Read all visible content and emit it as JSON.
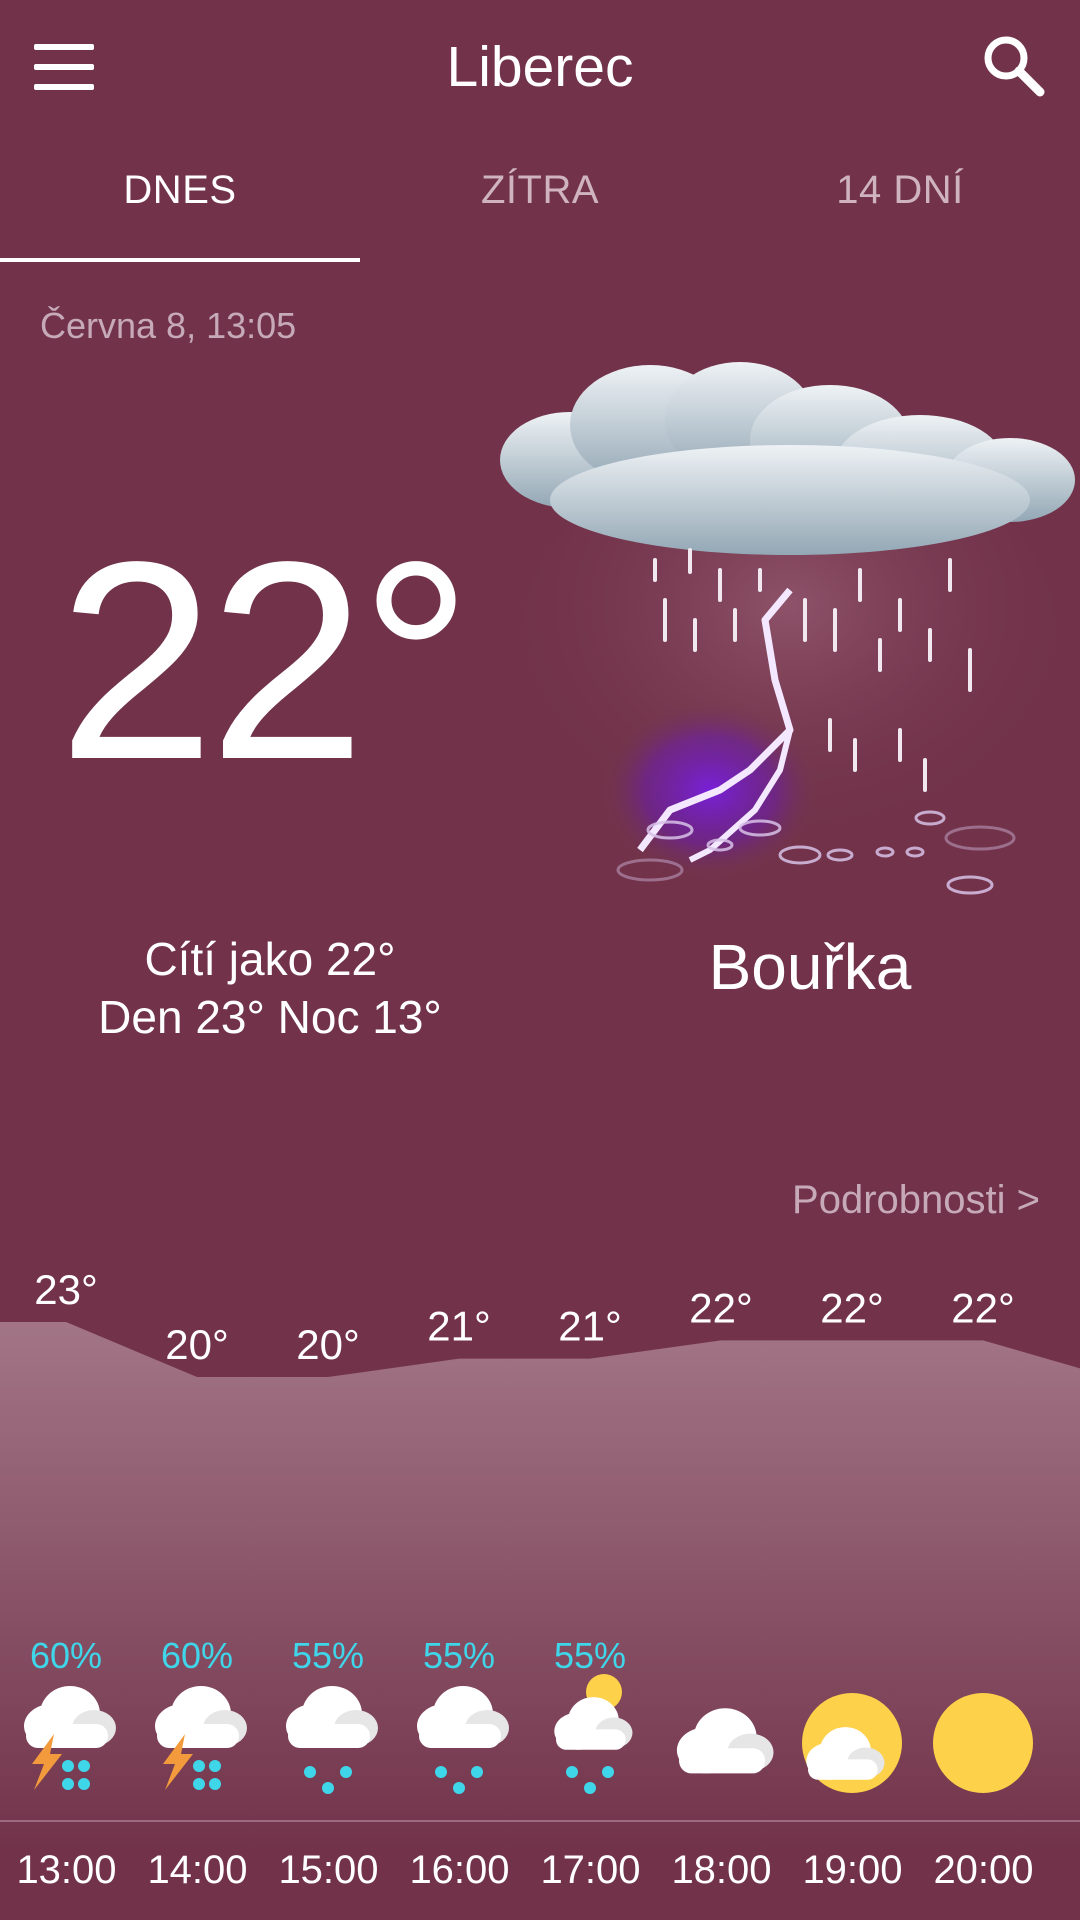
{
  "header": {
    "city": "Liberec",
    "menu_icon": "hamburger-menu-icon",
    "search_icon": "search-icon"
  },
  "tabs": [
    {
      "label": "DNES",
      "active": true
    },
    {
      "label": "ZÍTRA",
      "active": false
    },
    {
      "label": "14 DNÍ",
      "active": false
    }
  ],
  "current": {
    "datetime": "Června 8, 13:05",
    "temperature": "22°",
    "feels_like": "Cítí jako 22°",
    "day_night": "Den 23° Noc 13°",
    "condition": "Bouřka",
    "condition_icon": "thunderstorm-icon"
  },
  "details_link": "Podrobnosti >",
  "colors": {
    "background": "#72334a",
    "precip_text": "#3fd6ea",
    "sun": "#fdd14a",
    "lightning": "#f39b3c",
    "rain_drop": "#3fd6ea"
  },
  "chart_data": {
    "type": "area",
    "x": [
      "13:00",
      "14:00",
      "15:00",
      "16:00",
      "17:00",
      "18:00",
      "19:00",
      "20:00"
    ],
    "values": [
      23,
      20,
      20,
      21,
      21,
      22,
      22,
      22
    ],
    "value_labels": [
      "23°",
      "20°",
      "20°",
      "21°",
      "21°",
      "22°",
      "22°",
      "22°"
    ],
    "precipitation": [
      "60%",
      "60%",
      "55%",
      "55%",
      "55%",
      "",
      "",
      ""
    ],
    "icons": [
      "thunder-rain-icon",
      "thunder-rain-icon",
      "rain-cloud-icon",
      "rain-cloud-icon",
      "sun-cloud-rain-icon",
      "cloud-icon",
      "sun-cloud-icon",
      "sun-icon"
    ],
    "ylim": [
      20,
      23
    ],
    "grid": false
  }
}
